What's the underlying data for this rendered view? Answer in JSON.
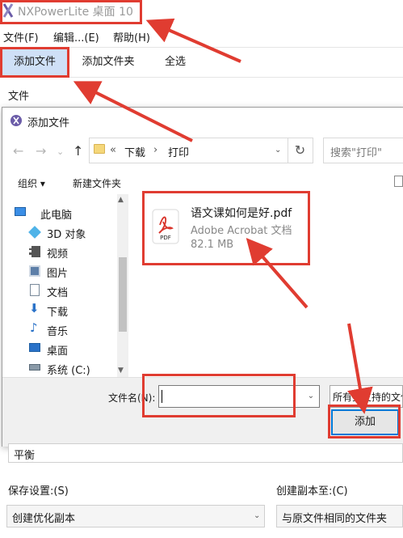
{
  "app": {
    "title": "NXPowerLite 桌面 10",
    "menu": [
      "文件(F)",
      "编辑...(E)",
      "帮助(H)"
    ],
    "toolbar": {
      "add_file": "添加文件",
      "add_folder": "添加文件夹",
      "select_all": "全选"
    },
    "column_header": "文件",
    "balance": "平衡",
    "save_settings_label": "保存设置:(S)",
    "save_settings_value": "创建优化副本",
    "copy_to_label": "创建副本至:(C)",
    "copy_to_value": "与原文件相同的文件夹"
  },
  "dialog": {
    "title": "添加文件",
    "path": [
      "下载",
      "打印"
    ],
    "path_prefix": "«",
    "search_placeholder": "搜索\"打印\"",
    "commands": {
      "organize": "组织 ▾",
      "new_folder": "新建文件夹"
    },
    "nav_items": [
      {
        "label": "此电脑",
        "icon": "computer-icon"
      },
      {
        "label": "3D 对象",
        "icon": "3d-objects-icon"
      },
      {
        "label": "视频",
        "icon": "video-icon"
      },
      {
        "label": "图片",
        "icon": "pictures-icon"
      },
      {
        "label": "文档",
        "icon": "documents-icon"
      },
      {
        "label": "下载",
        "icon": "download-icon"
      },
      {
        "label": "音乐",
        "icon": "music-icon"
      },
      {
        "label": "桌面",
        "icon": "desktop-icon"
      },
      {
        "label": "系统 (C:)",
        "icon": "drive-icon"
      }
    ],
    "file": {
      "name": "语文课如何是好.pdf",
      "type": "Adobe Acrobat 文档",
      "size": "82.1 MB"
    },
    "filename_label": "文件名(N):",
    "filename_value": "",
    "filter": "所有受支持的文件",
    "add_button": "添加"
  },
  "colors": {
    "annotation": "#e03c31",
    "selected_toolbar": "#cfe0f7",
    "accent": "#0078d7"
  }
}
